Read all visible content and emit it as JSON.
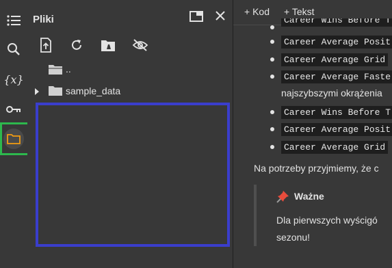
{
  "panel": {
    "title": "Pliki",
    "folder_items": [
      {
        "name": ".."
      },
      {
        "name": "sample_data"
      }
    ]
  },
  "main_toolbar": {
    "add_code_label": "Kod",
    "add_text_label": "Tekst"
  },
  "content": {
    "list_items": [
      "Career Wins Before T",
      "Career Average Posit",
      "Career Average Grid",
      "Career Average Faste",
      "najszybszymi okrążenia",
      "Career Wins Before T",
      "Career Average Posit",
      "Career Average Grid"
    ],
    "paragraph": "Na potrzeby przyjmiemy, że c",
    "callout": {
      "title": "Ważne",
      "line1": "Dla pierwszych wyścigó",
      "line2": "sezonu!"
    }
  },
  "colors": {
    "highlight_green": "#2db84d",
    "highlight_blue": "#3a3ecc",
    "active_folder": "#f39c12",
    "pin_red": "#e74c3c"
  }
}
